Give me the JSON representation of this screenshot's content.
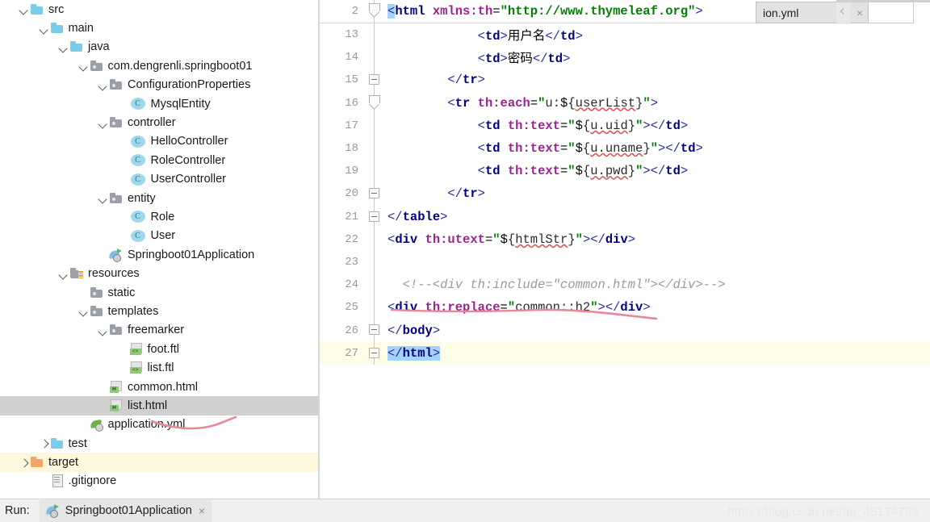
{
  "project_tree": {
    "name": "Project tool window",
    "items": [
      {
        "label": "src",
        "indent": 1,
        "twisty": "down",
        "icon": "folder-blue",
        "state": "normal"
      },
      {
        "label": "main",
        "indent": 2,
        "twisty": "down",
        "icon": "folder-blue",
        "state": "normal"
      },
      {
        "label": "java",
        "indent": 3,
        "twisty": "down",
        "icon": "folder-blue",
        "state": "normal"
      },
      {
        "label": "com.dengrenli.springboot01",
        "indent": 4,
        "twisty": "down",
        "icon": "package",
        "state": "normal"
      },
      {
        "label": "ConfigurationProperties",
        "indent": 5,
        "twisty": "down",
        "icon": "package",
        "state": "normal"
      },
      {
        "label": "MysqlEntity",
        "indent": 6,
        "twisty": "none",
        "icon": "java-class",
        "state": "normal"
      },
      {
        "label": "controller",
        "indent": 5,
        "twisty": "down",
        "icon": "package",
        "state": "normal"
      },
      {
        "label": "HelloController",
        "indent": 6,
        "twisty": "none",
        "icon": "java-class",
        "state": "normal"
      },
      {
        "label": "RoleController",
        "indent": 6,
        "twisty": "none",
        "icon": "java-class",
        "state": "normal"
      },
      {
        "label": "UserController",
        "indent": 6,
        "twisty": "none",
        "icon": "java-class",
        "state": "normal"
      },
      {
        "label": "entity",
        "indent": 5,
        "twisty": "down",
        "icon": "package",
        "state": "normal"
      },
      {
        "label": "Role",
        "indent": 6,
        "twisty": "none",
        "icon": "java-class",
        "state": "normal"
      },
      {
        "label": "User",
        "indent": 6,
        "twisty": "none",
        "icon": "java-class",
        "state": "normal"
      },
      {
        "label": "Springboot01Application",
        "indent": 5,
        "twisty": "none",
        "icon": "spring-run",
        "state": "normal"
      },
      {
        "label": "resources",
        "indent": 3,
        "twisty": "down",
        "icon": "resources",
        "state": "normal"
      },
      {
        "label": "static",
        "indent": 4,
        "twisty": "none",
        "icon": "package",
        "state": "normal"
      },
      {
        "label": "templates",
        "indent": 4,
        "twisty": "down",
        "icon": "package",
        "state": "normal"
      },
      {
        "label": "freemarker",
        "indent": 5,
        "twisty": "down",
        "icon": "package",
        "state": "normal"
      },
      {
        "label": "foot.ftl",
        "indent": 6,
        "twisty": "none",
        "icon": "ftl-file",
        "state": "normal"
      },
      {
        "label": "list.ftl",
        "indent": 6,
        "twisty": "none",
        "icon": "ftl-file",
        "state": "normal"
      },
      {
        "label": "common.html",
        "indent": 5,
        "twisty": "none",
        "icon": "html-file",
        "state": "normal"
      },
      {
        "label": "list.html",
        "indent": 5,
        "twisty": "none",
        "icon": "html-file",
        "state": "selected"
      },
      {
        "label": "application.yml",
        "indent": 4,
        "twisty": "none",
        "icon": "spring-leaf",
        "state": "normal"
      },
      {
        "label": "test",
        "indent": 2,
        "twisty": "right",
        "icon": "folder-blue",
        "state": "normal"
      },
      {
        "label": "target",
        "indent": 1,
        "twisty": "right",
        "icon": "folder-orange",
        "state": "highlight"
      },
      {
        "label": ".gitignore",
        "indent": 2,
        "twisty": "none",
        "icon": "plain-file",
        "state": "normal"
      }
    ]
  },
  "editor": {
    "sticky_line": {
      "number": "2",
      "fold": "arrow",
      "tokens": [
        {
          "t": "<",
          "c": "tk-br",
          "sel": true
        },
        {
          "t": "html",
          "c": "tk-tag"
        },
        {
          "t": " ",
          "c": "tk-el"
        },
        {
          "t": "xmlns:th",
          "c": "tk-attr"
        },
        {
          "t": "=",
          "c": "tk-eq"
        },
        {
          "t": "\"http://www.thymeleaf.org\"",
          "c": "tk-str"
        },
        {
          "t": ">",
          "c": "tk-br"
        }
      ]
    },
    "lines": [
      {
        "number": "13",
        "fold": "none",
        "current": false,
        "tokens": [
          {
            "t": "            ",
            "c": "tk-el"
          },
          {
            "t": "<",
            "c": "tk-br"
          },
          {
            "t": "td",
            "c": "tk-tag"
          },
          {
            "t": ">",
            "c": "tk-br"
          },
          {
            "t": "用户名",
            "c": "tk-el"
          },
          {
            "t": "</",
            "c": "tk-br"
          },
          {
            "t": "td",
            "c": "tk-tag"
          },
          {
            "t": ">",
            "c": "tk-br"
          }
        ]
      },
      {
        "number": "14",
        "fold": "none",
        "current": false,
        "tokens": [
          {
            "t": "            ",
            "c": "tk-el"
          },
          {
            "t": "<",
            "c": "tk-br"
          },
          {
            "t": "td",
            "c": "tk-tag"
          },
          {
            "t": ">",
            "c": "tk-br"
          },
          {
            "t": "密码",
            "c": "tk-el"
          },
          {
            "t": "</",
            "c": "tk-br"
          },
          {
            "t": "td",
            "c": "tk-tag"
          },
          {
            "t": ">",
            "c": "tk-br"
          }
        ]
      },
      {
        "number": "15",
        "fold": "minus",
        "current": false,
        "tokens": [
          {
            "t": "        ",
            "c": "tk-el"
          },
          {
            "t": "</",
            "c": "tk-br"
          },
          {
            "t": "tr",
            "c": "tk-tag"
          },
          {
            "t": ">",
            "c": "tk-br"
          }
        ]
      },
      {
        "number": "16",
        "fold": "arrow",
        "current": false,
        "tokens": [
          {
            "t": "        ",
            "c": "tk-el"
          },
          {
            "t": "<",
            "c": "tk-br"
          },
          {
            "t": "tr",
            "c": "tk-tag"
          },
          {
            "t": " ",
            "c": "tk-el"
          },
          {
            "t": "th:each",
            "c": "tk-attr"
          },
          {
            "t": "=",
            "c": "tk-eq"
          },
          {
            "t": "\"",
            "c": "tk-str"
          },
          {
            "t": "u:",
            "c": "tk-val"
          },
          {
            "t": "$",
            "c": "tk-el"
          },
          {
            "t": "{",
            "c": "tk-val"
          },
          {
            "t": "userList",
            "c": "tk-val squig"
          },
          {
            "t": "}",
            "c": "tk-val"
          },
          {
            "t": "\"",
            "c": "tk-str"
          },
          {
            "t": ">",
            "c": "tk-br"
          }
        ]
      },
      {
        "number": "17",
        "fold": "none",
        "current": false,
        "tokens": [
          {
            "t": "            ",
            "c": "tk-el"
          },
          {
            "t": "<",
            "c": "tk-br"
          },
          {
            "t": "td",
            "c": "tk-tag"
          },
          {
            "t": " ",
            "c": "tk-el"
          },
          {
            "t": "th:text",
            "c": "tk-attr"
          },
          {
            "t": "=",
            "c": "tk-eq"
          },
          {
            "t": "\"",
            "c": "tk-str"
          },
          {
            "t": "$",
            "c": "tk-el"
          },
          {
            "t": "{",
            "c": "tk-val"
          },
          {
            "t": "u.uid",
            "c": "tk-val squig"
          },
          {
            "t": "}",
            "c": "tk-val"
          },
          {
            "t": "\"",
            "c": "tk-str"
          },
          {
            "t": ">",
            "c": "tk-br"
          },
          {
            "t": "</",
            "c": "tk-br"
          },
          {
            "t": "td",
            "c": "tk-tag"
          },
          {
            "t": ">",
            "c": "tk-br"
          }
        ]
      },
      {
        "number": "18",
        "fold": "none",
        "current": false,
        "tokens": [
          {
            "t": "            ",
            "c": "tk-el"
          },
          {
            "t": "<",
            "c": "tk-br"
          },
          {
            "t": "td",
            "c": "tk-tag"
          },
          {
            "t": " ",
            "c": "tk-el"
          },
          {
            "t": "th:text",
            "c": "tk-attr"
          },
          {
            "t": "=",
            "c": "tk-eq"
          },
          {
            "t": "\"",
            "c": "tk-str"
          },
          {
            "t": "$",
            "c": "tk-el"
          },
          {
            "t": "{",
            "c": "tk-val"
          },
          {
            "t": "u.uname",
            "c": "tk-val squig"
          },
          {
            "t": "}",
            "c": "tk-val"
          },
          {
            "t": "\"",
            "c": "tk-str"
          },
          {
            "t": ">",
            "c": "tk-br"
          },
          {
            "t": "</",
            "c": "tk-br"
          },
          {
            "t": "td",
            "c": "tk-tag"
          },
          {
            "t": ">",
            "c": "tk-br"
          }
        ]
      },
      {
        "number": "19",
        "fold": "none",
        "current": false,
        "tokens": [
          {
            "t": "            ",
            "c": "tk-el"
          },
          {
            "t": "<",
            "c": "tk-br"
          },
          {
            "t": "td",
            "c": "tk-tag"
          },
          {
            "t": " ",
            "c": "tk-el"
          },
          {
            "t": "th:text",
            "c": "tk-attr"
          },
          {
            "t": "=",
            "c": "tk-eq"
          },
          {
            "t": "\"",
            "c": "tk-str"
          },
          {
            "t": "$",
            "c": "tk-el"
          },
          {
            "t": "{",
            "c": "tk-val"
          },
          {
            "t": "u.pwd",
            "c": "tk-val squig"
          },
          {
            "t": "}",
            "c": "tk-val"
          },
          {
            "t": "\"",
            "c": "tk-str"
          },
          {
            "t": ">",
            "c": "tk-br"
          },
          {
            "t": "</",
            "c": "tk-br"
          },
          {
            "t": "td",
            "c": "tk-tag"
          },
          {
            "t": ">",
            "c": "tk-br"
          }
        ]
      },
      {
        "number": "20",
        "fold": "minus",
        "current": false,
        "tokens": [
          {
            "t": "        ",
            "c": "tk-el"
          },
          {
            "t": "</",
            "c": "tk-br"
          },
          {
            "t": "tr",
            "c": "tk-tag"
          },
          {
            "t": ">",
            "c": "tk-br"
          }
        ]
      },
      {
        "number": "21",
        "fold": "minus",
        "current": false,
        "tokens": [
          {
            "t": "</",
            "c": "tk-br"
          },
          {
            "t": "table",
            "c": "tk-tag"
          },
          {
            "t": ">",
            "c": "tk-br"
          }
        ]
      },
      {
        "number": "22",
        "fold": "none",
        "current": false,
        "tokens": [
          {
            "t": "<",
            "c": "tk-br"
          },
          {
            "t": "div",
            "c": "tk-tag"
          },
          {
            "t": " ",
            "c": "tk-el"
          },
          {
            "t": "th:utext",
            "c": "tk-attr"
          },
          {
            "t": "=",
            "c": "tk-eq"
          },
          {
            "t": "\"",
            "c": "tk-str"
          },
          {
            "t": "$",
            "c": "tk-el"
          },
          {
            "t": "{",
            "c": "tk-val"
          },
          {
            "t": "htmlStr",
            "c": "tk-val squig"
          },
          {
            "t": "}",
            "c": "tk-val"
          },
          {
            "t": "\"",
            "c": "tk-str"
          },
          {
            "t": ">",
            "c": "tk-br"
          },
          {
            "t": "</",
            "c": "tk-br"
          },
          {
            "t": "div",
            "c": "tk-tag"
          },
          {
            "t": ">",
            "c": "tk-br"
          }
        ]
      },
      {
        "number": "23",
        "fold": "none",
        "current": false,
        "tokens": []
      },
      {
        "number": "24",
        "fold": "none",
        "current": false,
        "tokens": [
          {
            "t": "  <!--<div th:include=\"common.html\"></div>-->",
            "c": "tk-comment"
          }
        ]
      },
      {
        "number": "25",
        "fold": "none",
        "current": false,
        "tokens": [
          {
            "t": "<",
            "c": "tk-br"
          },
          {
            "t": "div",
            "c": "tk-tag"
          },
          {
            "t": " ",
            "c": "tk-el"
          },
          {
            "t": "th:replace",
            "c": "tk-attr"
          },
          {
            "t": "=",
            "c": "tk-eq"
          },
          {
            "t": "\"",
            "c": "tk-str"
          },
          {
            "t": "common::h2",
            "c": "tk-val"
          },
          {
            "t": "\"",
            "c": "tk-str"
          },
          {
            "t": ">",
            "c": "tk-br"
          },
          {
            "t": "</",
            "c": "tk-br"
          },
          {
            "t": "div",
            "c": "tk-tag"
          },
          {
            "t": ">",
            "c": "tk-br"
          }
        ]
      },
      {
        "number": "26",
        "fold": "minus",
        "current": false,
        "tokens": [
          {
            "t": "</",
            "c": "tk-br"
          },
          {
            "t": "body",
            "c": "tk-tag"
          },
          {
            "t": ">",
            "c": "tk-br"
          }
        ]
      },
      {
        "number": "27",
        "fold": "minus",
        "current": true,
        "tokens": [
          {
            "t": "</",
            "c": "tk-br sel"
          },
          {
            "t": "html",
            "c": "tk-tag sel"
          },
          {
            "t": ">",
            "c": "tk-br sel"
          }
        ]
      }
    ]
  },
  "tab_strip": {
    "active_tab_label": "ion.yml",
    "close_icon": "×"
  },
  "bottom_bar": {
    "run_label": "Run:",
    "run_tab_label": "Springboot01Application",
    "close_icon": "×"
  },
  "watermark": {
    "text": "https://blog.csdn.net/qq_45174759"
  }
}
